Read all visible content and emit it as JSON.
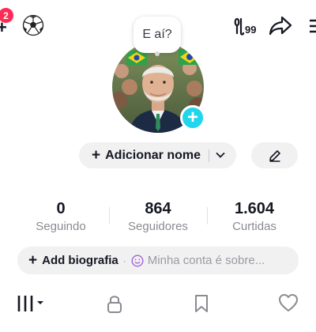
{
  "top_bar": {
    "notification_count": "2",
    "add_symbol": "+",
    "icons": [
      "plus-icon",
      "soccer-ball-icon",
      "badge-99-icon",
      "share-icon",
      "menu-icon"
    ]
  },
  "profile": {
    "avatar_bubble_text": "E aí?",
    "add_photo_symbol": "+",
    "add_name_symbol": "+",
    "add_name_label": "Adicionar nome"
  },
  "stats": [
    {
      "value": "0",
      "label": "Seguindo"
    },
    {
      "value": "864",
      "label": "Seguidores"
    },
    {
      "value": "1.604",
      "label": "Curtidas"
    }
  ],
  "bio": {
    "add_symbol": "+",
    "add_label": "Add biografia",
    "separator": "·",
    "placeholder": "Minha conta é sobre..."
  },
  "tabs": [
    "videos-grid-icon",
    "lock-icon",
    "bookmark-icon",
    "heart-icon"
  ],
  "colors": {
    "accent": "#fe2c55",
    "add_photo": "#20d5ec",
    "button_bg": "#f1f1f2",
    "muted_text": "#8a8b91"
  }
}
